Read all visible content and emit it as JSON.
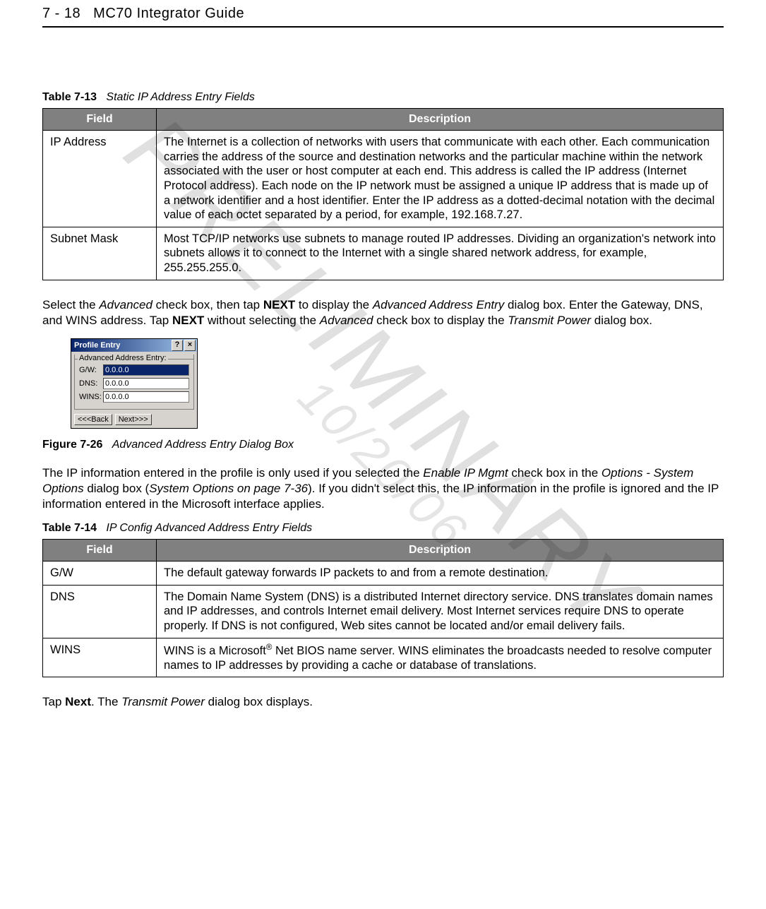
{
  "header": {
    "page_num": "7 - 18",
    "title": "MC70 Integrator Guide"
  },
  "watermark1": "PRELIMINARY",
  "watermark2": "10/20/06",
  "table713": {
    "caption_label": "Table 7-13",
    "caption_text": "Static IP Address Entry Fields",
    "headers": {
      "field": "Field",
      "description": "Description"
    },
    "rows": [
      {
        "field": "IP Address",
        "desc": "The Internet is a collection of networks with users that communicate with each other. Each communication carries the address of the source and destination networks and the particular machine within the network associated with the user or host computer at each end. This address is called the IP address (Internet Protocol address). Each node on the IP network must be assigned a unique IP address that is made up of a network identifier and a host identifier. Enter the IP address as a dotted-decimal notation with the decimal value of each octet separated by a period, for example, 192.168.7.27."
      },
      {
        "field": "Subnet Mask",
        "desc": "Most TCP/IP networks use subnets to manage routed IP addresses. Dividing an organization's network into subnets allows it to connect to the Internet with a single shared network address, for example, 255.255.255.0."
      }
    ]
  },
  "para1": {
    "p1a": "Select the ",
    "p1b": "Advanced",
    "p1c": " check box, then tap ",
    "p1d": "NEXT",
    "p1e": " to display the ",
    "p1f": "Advanced Address Entry",
    "p1g": " dialog box. Enter the Gateway, DNS, and WINS address. Tap ",
    "p1h": "NEXT",
    "p1i": " without selecting the ",
    "p1j": "Advanced",
    "p1k": " check box to display the ",
    "p1l": "Transmit Power",
    "p1m": " dialog box."
  },
  "dialog": {
    "title": "Profile Entry",
    "help": "?",
    "close": "×",
    "group_label": "Advanced Address Entry:",
    "rows": {
      "gw": {
        "label": "G/W:",
        "value": "0.0.0.0"
      },
      "dns": {
        "label": "DNS:",
        "value": "0.0.0.0"
      },
      "wins": {
        "label": "WINS:",
        "value": "0.0.0.0"
      }
    },
    "back": "<<<Back",
    "next": "Next>>>"
  },
  "figure726": {
    "label": "Figure 7-26",
    "text": "Advanced Address Entry Dialog Box"
  },
  "para2": {
    "p2a": "The IP information entered in the profile is only used if you selected the ",
    "p2b": "Enable IP Mgmt",
    "p2c": " check box in the ",
    "p2d": "Options - System Options",
    "p2e": " dialog box (",
    "p2f": "System Options on page 7-36",
    "p2g": "). If you didn't select this, the IP information in the profile is ignored and the IP information entered in the Microsoft interface applies."
  },
  "table714": {
    "caption_label": "Table 7-14",
    "caption_text": "IP Config Advanced Address Entry Fields",
    "headers": {
      "field": "Field",
      "description": "Description"
    },
    "rows": [
      {
        "field": "G/W",
        "desc": "The default gateway forwards IP packets to and from a remote destination."
      },
      {
        "field": "DNS",
        "desc": "The Domain Name System (DNS) is a distributed Internet directory service. DNS translates domain names and IP addresses, and controls Internet email delivery. Most Internet services require DNS to operate properly. If DNS is not configured, Web sites cannot be located and/or email delivery fails."
      },
      {
        "field": "WINS",
        "desc_pre": "WINS is a Microsoft",
        "desc_sup": "®",
        "desc_post": " Net BIOS name server. WINS eliminates the broadcasts needed to resolve computer names to IP addresses by providing a cache or database of translations."
      }
    ]
  },
  "para3": {
    "p3a": "Tap ",
    "p3b": "Next",
    "p3c": ". The ",
    "p3d": "Transmit Power",
    "p3e": " dialog box displays."
  }
}
